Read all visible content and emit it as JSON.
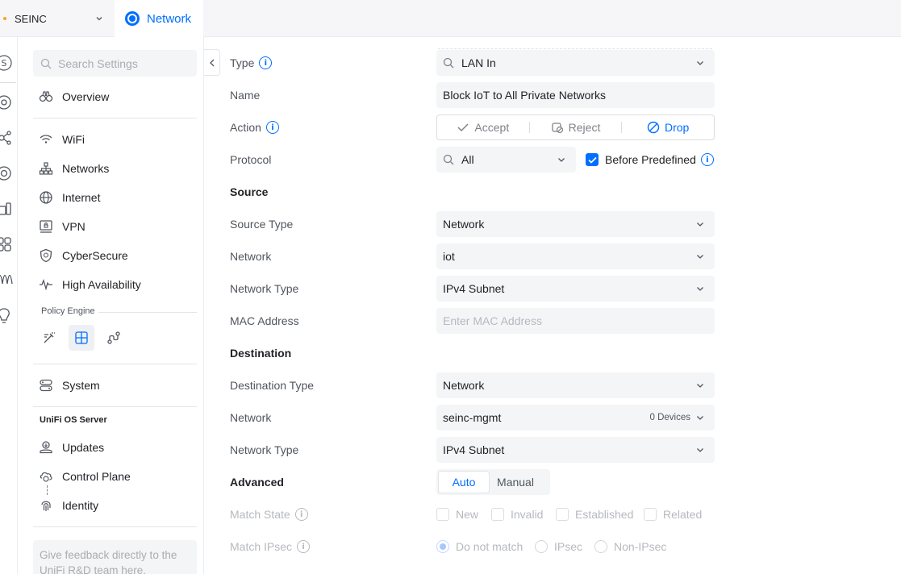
{
  "topbar": {
    "site_name": "SEINC",
    "app_name": "Network"
  },
  "sidebar": {
    "search_placeholder": "Search Settings",
    "items": [
      {
        "label": "Overview",
        "icon": "binoculars-icon"
      },
      {
        "label": "WiFi",
        "icon": "wifi-icon"
      },
      {
        "label": "Networks",
        "icon": "network-tree-icon"
      },
      {
        "label": "Internet",
        "icon": "globe-icon"
      },
      {
        "label": "VPN",
        "icon": "vpn-icon"
      },
      {
        "label": "CyberSecure",
        "icon": "shield-icon"
      },
      {
        "label": "High Availability",
        "icon": "pulse-icon"
      }
    ],
    "policy_engine_label": "Policy Engine",
    "system_label": "System",
    "unifi_os_label": "UniFi OS Server",
    "os_items": [
      {
        "label": "Updates",
        "icon": "updates-icon"
      },
      {
        "label": "Control Plane",
        "icon": "control-plane-icon"
      },
      {
        "label": "Identity",
        "icon": "fingerprint-icon"
      }
    ],
    "feedback_text": "Give feedback directly to the UniFi R&D team here."
  },
  "form": {
    "type_label": "Type",
    "type_value": "LAN In",
    "name_label": "Name",
    "name_value": "Block IoT to All Private Networks",
    "action_label": "Action",
    "action_options": [
      "Accept",
      "Reject",
      "Drop"
    ],
    "action_selected": "Drop",
    "protocol_label": "Protocol",
    "protocol_value": "All",
    "before_predefined_label": "Before Predefined",
    "before_predefined_checked": true,
    "source_heading": "Source",
    "source_type_label": "Source Type",
    "source_type_value": "Network",
    "source_network_label": "Network",
    "source_network_value": "iot",
    "source_network_type_label": "Network Type",
    "source_network_type_value": "IPv4 Subnet",
    "mac_label": "MAC Address",
    "mac_placeholder": "Enter MAC Address",
    "destination_heading": "Destination",
    "dest_type_label": "Destination Type",
    "dest_type_value": "Network",
    "dest_network_label": "Network",
    "dest_network_value": "seinc-mgmt",
    "dest_network_devices": "0 Devices",
    "dest_network_type_label": "Network Type",
    "dest_network_type_value": "IPv4 Subnet",
    "advanced_heading": "Advanced",
    "advanced_options": [
      "Auto",
      "Manual"
    ],
    "advanced_selected": "Auto",
    "match_state_label": "Match State",
    "match_state_options": [
      "New",
      "Invalid",
      "Established",
      "Related"
    ],
    "match_ipsec_label": "Match IPsec",
    "match_ipsec_options": [
      "Do not match",
      "IPsec",
      "Non-IPsec"
    ],
    "match_ipsec_selected": "Do not match"
  },
  "colors": {
    "accent": "#006fff",
    "text": "#212327",
    "muted": "#50565e",
    "field_bg": "#f4f5f6"
  }
}
